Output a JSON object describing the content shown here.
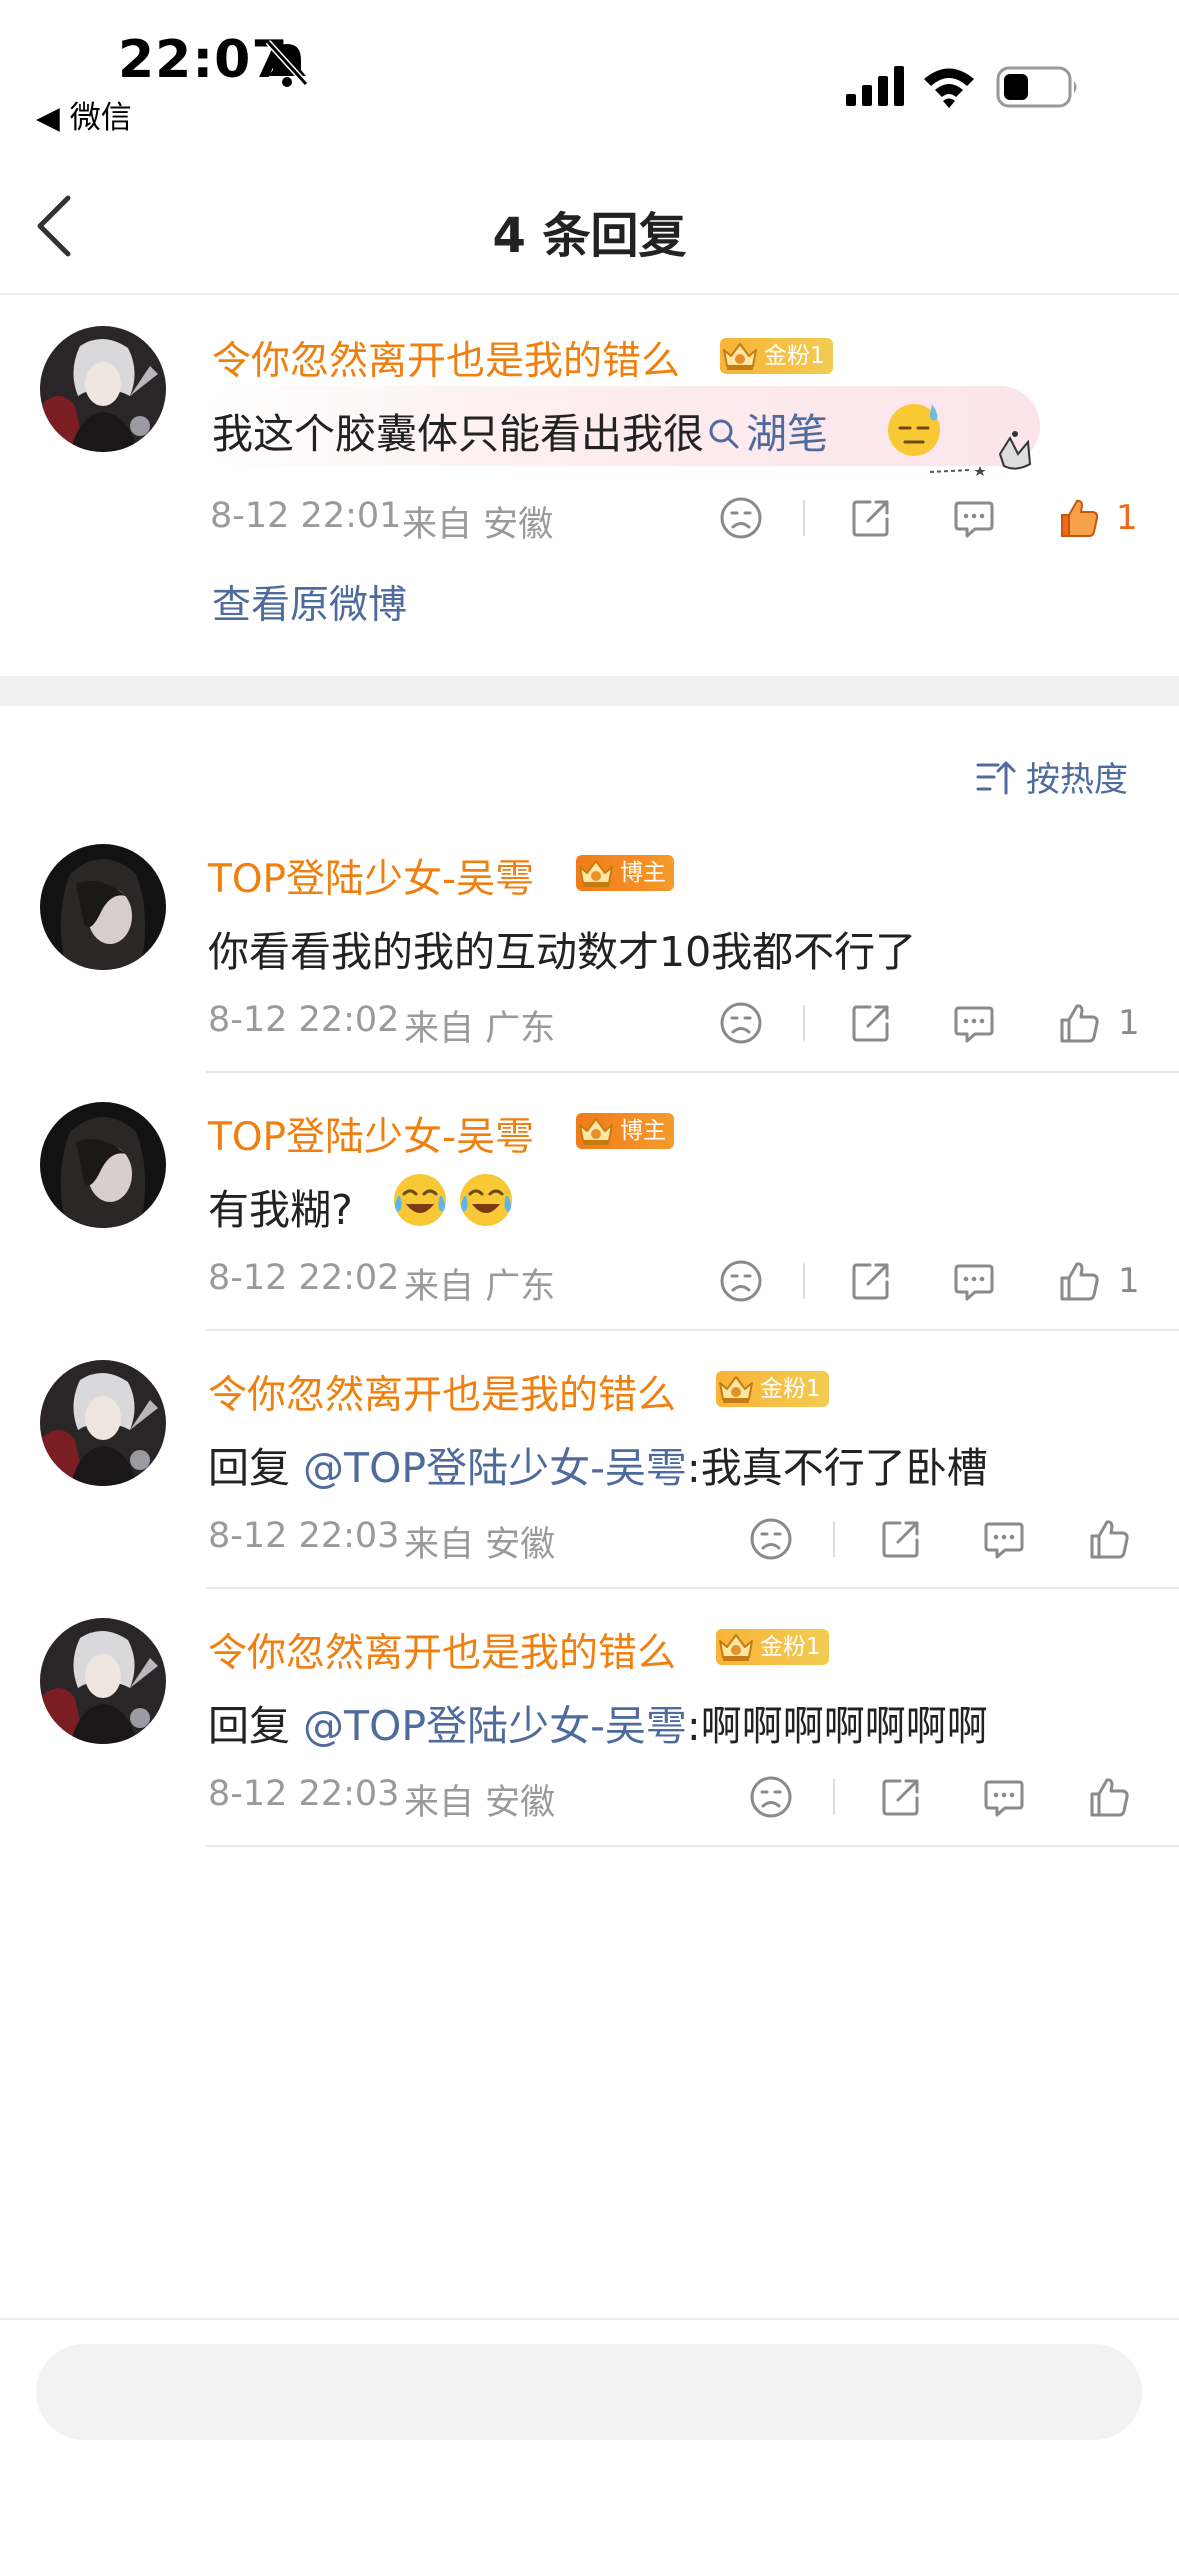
{
  "status_bar": {
    "time": "22:07",
    "back_app": "◀ 微信"
  },
  "header": {
    "title": "4 条回复"
  },
  "main_comment": {
    "username": "令你忽然离开也是我的错么",
    "badge": "金粉1",
    "text": "我这个胶囊体只能看出我很",
    "search_term": "湖笔",
    "timestamp": "8-12 22:01",
    "location": "来自 安徽",
    "like_count": "1",
    "view_original": "查看原微博"
  },
  "sort": {
    "label": "按热度"
  },
  "replies": [
    {
      "username": "TOP登陆少女-吴雩",
      "badge": "博主",
      "text": "你看看我的我的互动数才10我都不行了",
      "timestamp": "8-12 22:02",
      "location": "来自 广东",
      "like_count": "1"
    },
    {
      "username": "TOP登陆少女-吴雩",
      "badge": "博主",
      "text": "有我糊?",
      "timestamp": "8-12 22:02",
      "location": "来自 广东",
      "like_count": "1"
    },
    {
      "username": "令你忽然离开也是我的错么",
      "badge": "金粉1",
      "prefix": "回复 ",
      "mention": "@TOP登陆少女-吴雩",
      "text": ":我真不行了卧槽",
      "timestamp": "8-12 22:03",
      "location": "来自 安徽"
    },
    {
      "username": "令你忽然离开也是我的错么",
      "badge": "金粉1",
      "prefix": "回复 ",
      "mention": "@TOP登陆少女-吴雩",
      "text": ":啊啊啊啊啊啊啊",
      "timestamp": "8-12 22:03",
      "location": "来自 安徽"
    }
  ],
  "colors": {
    "username": "#f07f0f",
    "mention": "#4f6b9e",
    "liked": "#f06a1e",
    "meta": "#9a9a9a"
  },
  "icons": [
    "bell-slash-icon",
    "signal-icon",
    "wifi-icon",
    "battery-icon",
    "back-icon",
    "dislike-face-icon",
    "share-icon",
    "comment-icon",
    "thumb-up-icon",
    "sort-icon",
    "search-icon"
  ]
}
